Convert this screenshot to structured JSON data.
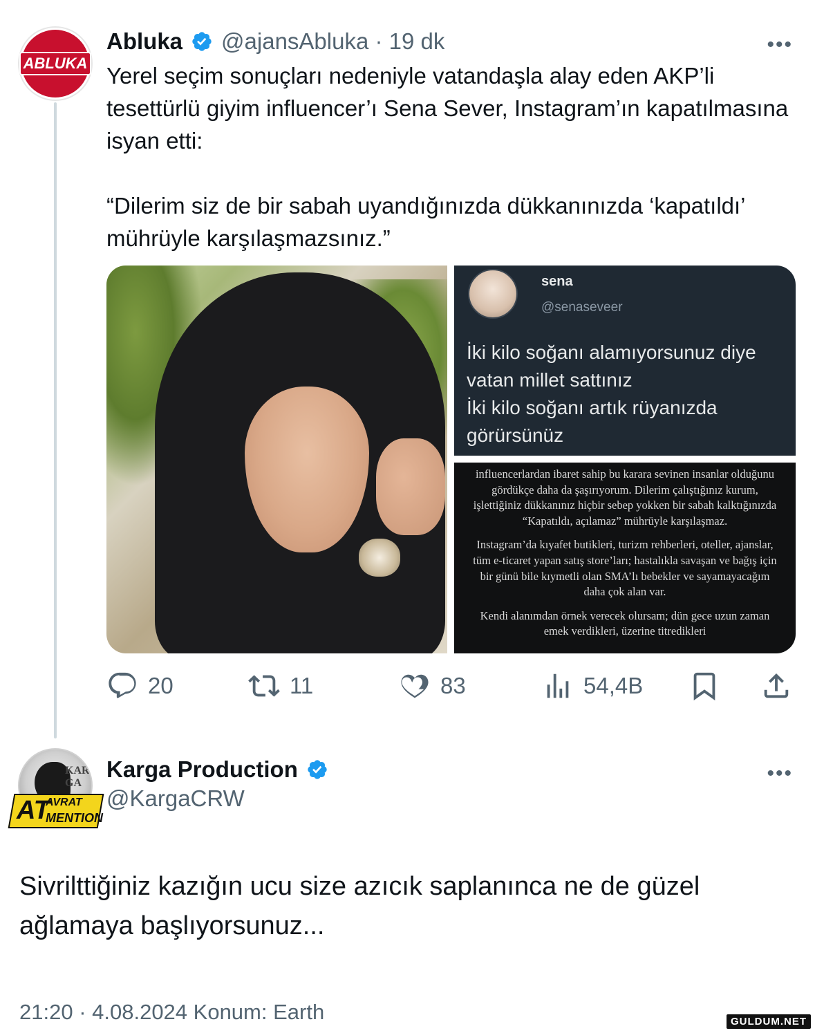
{
  "tweet1": {
    "avatar_logo_text": "ABLUKA",
    "name": "Abluka",
    "handle_time": "@ajansAbluka · 19 dk",
    "text": "Yerel seçim sonuçları nedeniyle vatandaşla alay eden AKP’li tesettürlü giyim influencer’ı Sena Sever, Instagram’ın kapatılmasına isyan etti:\n\n“Dilerim siz de bir sabah uyandığınızda dükkanınızda ‘kapatıldı’ mührüyle karşılaşmazsınız.”",
    "more_icon": "more-dots-icon",
    "media": {
      "embedded_post": {
        "name": "sena",
        "handle": "@senaseveer",
        "text": "İki kilo soğanı alamıyorsunuz diye vatan millet sattınız\nİki kilo soğanı artık rüyanızda görürsünüz"
      },
      "story_paragraphs": [
        "influencerlardan ibaret sahip bu karara sevinen insanlar olduğunu gördükçe daha da şaşırıyorum. Dilerim çalıştığınız kurum, işlettiğiniz dükkanınız hiçbir sebep yokken bir sabah kalktığınızda “Kapatıldı, açılamaz” mührüyle karşılaşmaz.",
        "Instagram’da kıyafet butikleri, turizm rehberleri, oteller, ajanslar, tüm e-ticaret yapan satış store’ları; hastalıkla savaşan ve bağış için bir günü bile kıymetli olan SMA’lı bebekler ve sayamayacağım daha çok alan var.",
        "Kendi alanımdan örnek verecek olursam; dün gece uzun zaman emek verdikleri, üzerine titredikleri"
      ]
    },
    "actions": {
      "reply_count": "20",
      "retweet_count": "11",
      "like_count": "83",
      "views_count": "54,4B"
    }
  },
  "tweet2": {
    "avatar_text_top": "KAR\nGA",
    "avatar_text_at": "AT",
    "avatar_text_avrat": "AVRAT",
    "avatar_text_mention": "MENTION",
    "name": "Karga Production",
    "handle": "@KargaCRW",
    "text": "Sivrilttiğiniz kazığın ucu size azıcık saplanınca ne de güzel ağlamaya başlıyorsunuz...",
    "meta": "21:20 · 4.08.2024 Konum: Earth"
  },
  "watermark": "GULDUM.NET",
  "colors": {
    "verified_blue": "#1d9bf0",
    "secondary_text": "#536471",
    "abluka_red": "#c8102e",
    "karga_yellow": "#f3d51c"
  }
}
